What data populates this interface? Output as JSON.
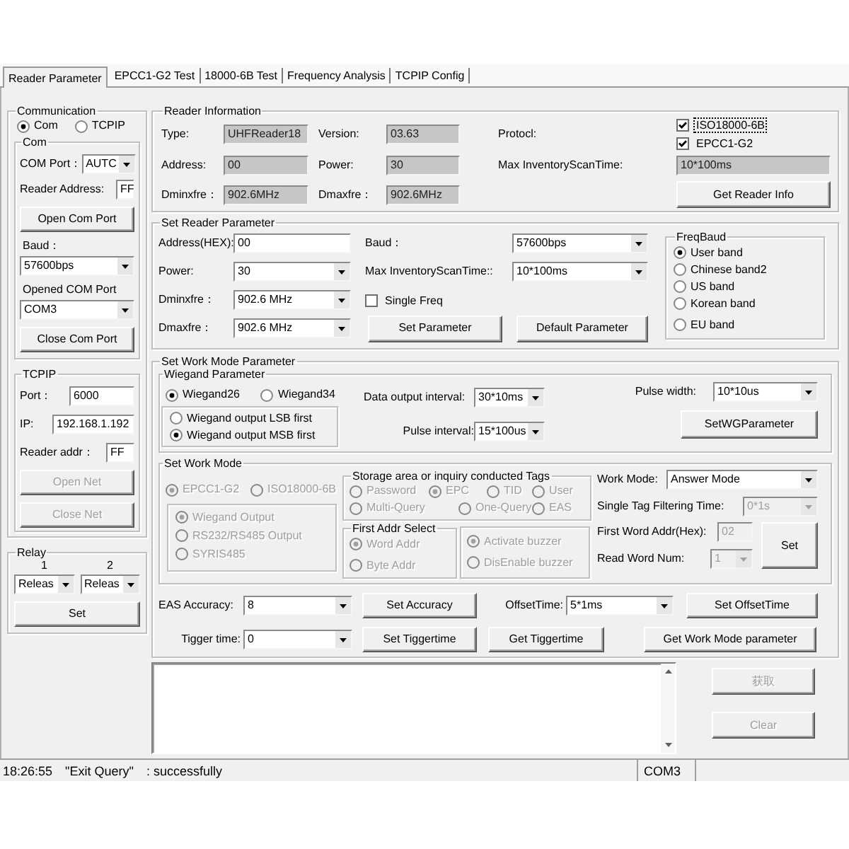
{
  "tabs": [
    {
      "label": "Reader Parameter",
      "selected": true
    },
    {
      "label": "EPCC1-G2 Test",
      "selected": false
    },
    {
      "label": "18000-6B Test",
      "selected": false
    },
    {
      "label": "Frequency Analysis",
      "selected": false
    },
    {
      "label": "TCPIP Config",
      "selected": false
    }
  ],
  "communication": {
    "title": "Communication",
    "modes": [
      {
        "label": "Com",
        "selected": true
      },
      {
        "label": "TCPIP",
        "selected": false
      }
    ],
    "com": {
      "title": "Com",
      "port": {
        "label": "COM Port：",
        "value": "AUTC"
      },
      "reader_address": {
        "label": "Reader Address:",
        "value": "FF"
      },
      "open_button": "Open Com Port",
      "baud": {
        "label": "Baud：",
        "value": "57600bps"
      },
      "opened_port": {
        "label": "Opened COM Port",
        "value": "COM3"
      },
      "close_button": "Close Com Port"
    },
    "tcpip": {
      "title": "TCPIP",
      "port": {
        "label": "Port：",
        "value": "6000"
      },
      "ip": {
        "label": "IP:",
        "value": "192.168.1.192"
      },
      "reader_addr": {
        "label": "Reader addr：",
        "value": "FF"
      },
      "buttons": [
        {
          "label": "Open Net",
          "disabled": true
        },
        {
          "label": "Close Net",
          "disabled": true
        }
      ]
    }
  },
  "relay": {
    "title": "Relay",
    "channels": [
      {
        "label": "1",
        "value": "Releas"
      },
      {
        "label": "2",
        "value": "Releas"
      }
    ],
    "button": "Set"
  },
  "reader_information": {
    "title": "Reader Information",
    "type": {
      "label": "Type:",
      "value": "UHFReader18"
    },
    "version": {
      "label": "Version:",
      "value": "03.63"
    },
    "protocol": {
      "label": "Protocl:",
      "options": [
        {
          "label": "ISO18000-6B",
          "checked": true,
          "focused": true
        },
        {
          "label": "EPCC1-G2",
          "checked": true,
          "focused": false
        }
      ]
    },
    "address": {
      "label": "Address:",
      "value": "00"
    },
    "power": {
      "label": "Power:",
      "value": "30"
    },
    "scan_time": {
      "label": "Max InventoryScanTime:",
      "value": "10*100ms"
    },
    "dminfre": {
      "label": "Dminxfre：",
      "value": "902.6MHz"
    },
    "dmaxfre": {
      "label": "Dmaxfre：",
      "value": "902.6MHz"
    },
    "button": "Get Reader Info"
  },
  "set_reader_parameter": {
    "title": "Set Reader Parameter",
    "address": {
      "label": "Address(HEX):",
      "value": "00"
    },
    "baud": {
      "label": "Baud：",
      "value": "57600bps"
    },
    "power": {
      "label": "Power:",
      "value": "30"
    },
    "scan_time": {
      "label": "Max InventoryScanTime::",
      "value": "10*100ms"
    },
    "dminfre": {
      "label": "Dminxfre：",
      "value": "902.6 MHz"
    },
    "single_freq": {
      "label": "Single Freq",
      "checked": false
    },
    "dmaxfre": {
      "label": "Dmaxfre：",
      "value": "902.6 MHz"
    },
    "set_button": "Set Parameter",
    "default_button": "Default Parameter",
    "freq_band": {
      "title": "FreqBaud",
      "options": [
        {
          "label": "User band",
          "selected": true
        },
        {
          "label": "Chinese band2",
          "selected": false
        },
        {
          "label": "US band",
          "selected": false
        },
        {
          "label": "Korean band",
          "selected": false
        },
        {
          "label": "EU band",
          "selected": false
        }
      ]
    }
  },
  "work_mode_parameter": {
    "title": "Set Work Mode Parameter",
    "wiegand": {
      "title": "Wiegand Parameter",
      "formats": [
        {
          "label": "Wiegand26",
          "selected": true
        },
        {
          "label": "Wiegand34",
          "selected": false
        }
      ],
      "bit_order": [
        {
          "label": "Wiegand output LSB first",
          "selected": false
        },
        {
          "label": "Wiegand output MSB first",
          "selected": true
        }
      ],
      "data_interval": {
        "label": "Data output interval:",
        "value": "30*10ms"
      },
      "pulse_interval": {
        "label": "Pulse interval:",
        "value": "15*100us"
      },
      "pulse_width": {
        "label": "Pulse width:",
        "value": "10*10us"
      },
      "button": "SetWGParameter"
    },
    "work_mode": {
      "title": "Set Work Mode",
      "protocols": [
        {
          "label": "EPCC1-G2",
          "selected": true,
          "disabled": true
        },
        {
          "label": "ISO18000-6B",
          "selected": false,
          "disabled": true
        }
      ],
      "outputs": [
        {
          "label": "Wiegand Output",
          "selected": true,
          "disabled": true
        },
        {
          "label": "RS232/RS485 Output",
          "selected": false,
          "disabled": true
        },
        {
          "label": "SYRIS485",
          "selected": false,
          "disabled": true
        }
      ],
      "storage": {
        "title": "Storage area or inquiry conducted Tags",
        "areas": [
          {
            "label": "Password",
            "selected": false,
            "disabled": true
          },
          {
            "label": "EPC",
            "selected": true,
            "disabled": true
          },
          {
            "label": "TID",
            "selected": false,
            "disabled": true
          },
          {
            "label": "User",
            "selected": false,
            "disabled": true
          }
        ],
        "queries": [
          {
            "label": "Multi-Query",
            "selected": false,
            "disabled": true
          },
          {
            "label": "One-Query",
            "selected": false,
            "disabled": true
          },
          {
            "label": "EAS",
            "selected": false,
            "disabled": true
          }
        ]
      },
      "first_addr": {
        "title": "First Addr Select",
        "options": [
          {
            "label": "Word Addr",
            "selected": true,
            "disabled": true
          },
          {
            "label": "Byte Addr",
            "selected": false,
            "disabled": true
          }
        ]
      },
      "buzzer": [
        {
          "label": "Activate buzzer",
          "selected": true,
          "disabled": true
        },
        {
          "label": "DisEnable buzzer",
          "selected": false,
          "disabled": true
        }
      ],
      "mode": {
        "label": "Work Mode:",
        "value": "Answer Mode",
        "disabled": false
      },
      "filter_time": {
        "label": "Single Tag Filtering Time:",
        "value": "0*1s",
        "disabled": true
      },
      "first_word_addr": {
        "label": "First Word Addr(Hex):",
        "value": "02",
        "disabled": true
      },
      "read_word_num": {
        "label": "Read Word Num:",
        "value": "1",
        "disabled": true
      },
      "button": "Set"
    },
    "eas_accuracy": {
      "label": "EAS Accuracy:",
      "value": "8"
    },
    "accuracy_button": "Set Accuracy",
    "offset_time": {
      "label": "OffsetTime:",
      "value": "5*1ms"
    },
    "offset_button": "Set OffsetTime",
    "trigger_time": {
      "label": "Tigger time:",
      "value": "0"
    },
    "trigger_buttons": [
      "Set Tiggertime",
      "Get Tiggertime",
      "Get Work Mode parameter"
    ]
  },
  "log": {
    "buttons": [
      {
        "label": "获取",
        "disabled": true
      },
      {
        "label": "Clear",
        "disabled": true
      }
    ]
  },
  "status_bar": {
    "time": "18:26:55",
    "command": "\"Exit Query\"",
    "result": ": successfully",
    "port": "COM3"
  }
}
